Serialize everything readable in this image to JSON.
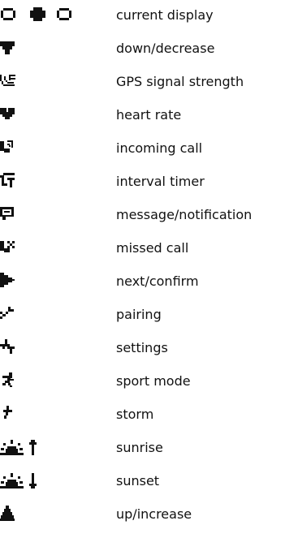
{
  "legend": {
    "items": [
      {
        "icon": "current-display-icon",
        "label": "current display"
      },
      {
        "icon": "down-decrease-icon",
        "label": "down/decrease"
      },
      {
        "icon": "gps-signal-strength-icon",
        "label": "GPS signal strength"
      },
      {
        "icon": "heart-rate-icon",
        "label": "heart rate"
      },
      {
        "icon": "incoming-call-icon",
        "label": "incoming call"
      },
      {
        "icon": "interval-timer-icon",
        "label": "interval timer"
      },
      {
        "icon": "message-notification-icon",
        "label": "message/notification"
      },
      {
        "icon": "missed-call-icon",
        "label": "missed call"
      },
      {
        "icon": "next-confirm-icon",
        "label": "next/confirm"
      },
      {
        "icon": "pairing-icon",
        "label": "pairing"
      },
      {
        "icon": "settings-icon",
        "label": "settings"
      },
      {
        "icon": "sport-mode-icon",
        "label": "sport mode"
      },
      {
        "icon": "storm-icon",
        "label": "storm"
      },
      {
        "icon": "sunrise-icon",
        "label": "sunrise"
      },
      {
        "icon": "sunset-icon",
        "label": "sunset"
      },
      {
        "icon": "up-increase-icon",
        "label": "up/increase"
      }
    ],
    "icon_color": "#111111"
  }
}
